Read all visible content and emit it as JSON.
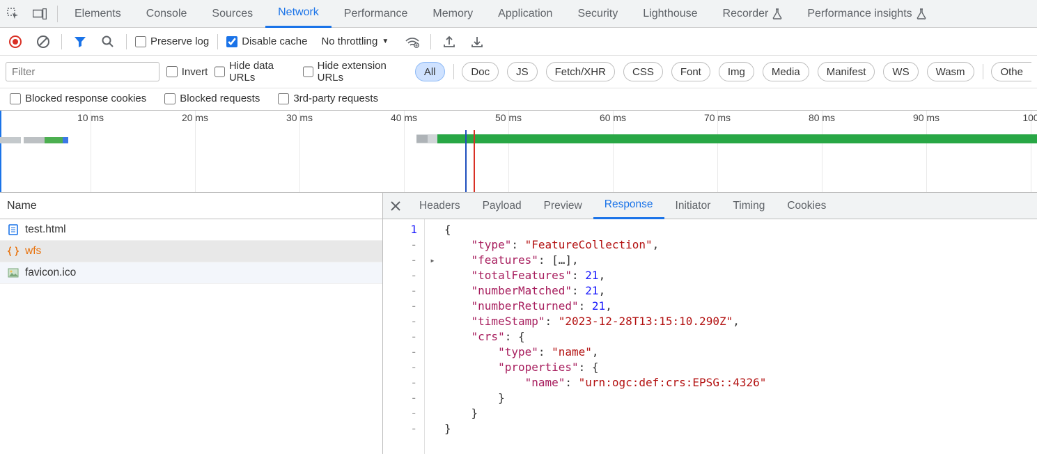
{
  "top_tabs": {
    "elements": "Elements",
    "console": "Console",
    "sources": "Sources",
    "network": "Network",
    "performance": "Performance",
    "memory": "Memory",
    "application": "Application",
    "security": "Security",
    "lighthouse": "Lighthouse",
    "recorder": "Recorder",
    "perf_insights": "Performance insights"
  },
  "toolbar": {
    "preserve_log": "Preserve log",
    "disable_cache": "Disable cache",
    "throttling": "No throttling"
  },
  "filter": {
    "placeholder": "Filter",
    "invert": "Invert",
    "hide_data_urls": "Hide data URLs",
    "hide_extension_urls": "Hide extension URLs",
    "all": "All",
    "doc": "Doc",
    "js": "JS",
    "fetch_xhr": "Fetch/XHR",
    "css": "CSS",
    "font": "Font",
    "img": "Img",
    "media": "Media",
    "manifest": "Manifest",
    "ws": "WS",
    "wasm": "Wasm",
    "other": "Othe"
  },
  "filter2": {
    "blocked_response_cookies": "Blocked response cookies",
    "blocked_requests": "Blocked requests",
    "third_party_requests": "3rd-party requests"
  },
  "timeline": {
    "ticks": [
      "10 ms",
      "20 ms",
      "30 ms",
      "40 ms",
      "50 ms",
      "60 ms",
      "70 ms",
      "80 ms",
      "90 ms",
      "100"
    ]
  },
  "list": {
    "header": "Name",
    "items": [
      {
        "name": "test.html",
        "kind": "document"
      },
      {
        "name": "wfs",
        "kind": "json"
      },
      {
        "name": "favicon.ico",
        "kind": "image"
      }
    ]
  },
  "detail_tabs": {
    "headers": "Headers",
    "payload": "Payload",
    "preview": "Preview",
    "response": "Response",
    "initiator": "Initiator",
    "timing": "Timing",
    "cookies": "Cookies"
  },
  "response_json": {
    "gutter": [
      "1",
      "-",
      "-",
      "-",
      "-",
      "-",
      "-",
      "-",
      "-",
      "-",
      "-",
      "-",
      "-",
      "-"
    ],
    "lines": [
      {
        "text": "{"
      },
      {
        "text": "    \"type\": \"FeatureCollection\",",
        "segs": [
          [
            "    ",
            "punc"
          ],
          [
            "\"type\"",
            "prop"
          ],
          [
            ": ",
            "punc"
          ],
          [
            "\"FeatureCollection\"",
            "str"
          ],
          [
            ",",
            "punc"
          ]
        ]
      },
      {
        "text": "    \"features\": […],",
        "segs": [
          [
            "    ",
            "punc"
          ],
          [
            "\"features\"",
            "prop"
          ],
          [
            ": [",
            "punc"
          ],
          [
            "…",
            "punc"
          ],
          [
            "],",
            "punc"
          ]
        ],
        "fold": true
      },
      {
        "text": "    \"totalFeatures\": 21,",
        "segs": [
          [
            "    ",
            "punc"
          ],
          [
            "\"totalFeatures\"",
            "prop"
          ],
          [
            ": ",
            "punc"
          ],
          [
            "21",
            "num"
          ],
          [
            ",",
            "punc"
          ]
        ]
      },
      {
        "text": "    \"numberMatched\": 21,",
        "segs": [
          [
            "    ",
            "punc"
          ],
          [
            "\"numberMatched\"",
            "prop"
          ],
          [
            ": ",
            "punc"
          ],
          [
            "21",
            "num"
          ],
          [
            ",",
            "punc"
          ]
        ]
      },
      {
        "text": "    \"numberReturned\": 21,",
        "segs": [
          [
            "    ",
            "punc"
          ],
          [
            "\"numberReturned\"",
            "prop"
          ],
          [
            ": ",
            "punc"
          ],
          [
            "21",
            "num"
          ],
          [
            ",",
            "punc"
          ]
        ]
      },
      {
        "text": "    \"timeStamp\": \"2023-12-28T13:15:10.290Z\",",
        "segs": [
          [
            "    ",
            "punc"
          ],
          [
            "\"timeStamp\"",
            "prop"
          ],
          [
            ": ",
            "punc"
          ],
          [
            "\"2023-12-28T13:15:10.290Z\"",
            "str"
          ],
          [
            ",",
            "punc"
          ]
        ]
      },
      {
        "text": "    \"crs\": {",
        "segs": [
          [
            "    ",
            "punc"
          ],
          [
            "\"crs\"",
            "prop"
          ],
          [
            ": {",
            "punc"
          ]
        ]
      },
      {
        "text": "        \"type\": \"name\",",
        "segs": [
          [
            "        ",
            "punc"
          ],
          [
            "\"type\"",
            "prop"
          ],
          [
            ": ",
            "punc"
          ],
          [
            "\"name\"",
            "str"
          ],
          [
            ",",
            "punc"
          ]
        ]
      },
      {
        "text": "        \"properties\": {",
        "segs": [
          [
            "        ",
            "punc"
          ],
          [
            "\"properties\"",
            "prop"
          ],
          [
            ": {",
            "punc"
          ]
        ]
      },
      {
        "text": "            \"name\": \"urn:ogc:def:crs:EPSG::4326\"",
        "segs": [
          [
            "            ",
            "punc"
          ],
          [
            "\"name\"",
            "prop"
          ],
          [
            ": ",
            "punc"
          ],
          [
            "\"urn:ogc:def:crs:EPSG::4326\"",
            "str"
          ]
        ]
      },
      {
        "text": "        }"
      },
      {
        "text": "    }"
      },
      {
        "text": "}"
      }
    ]
  }
}
